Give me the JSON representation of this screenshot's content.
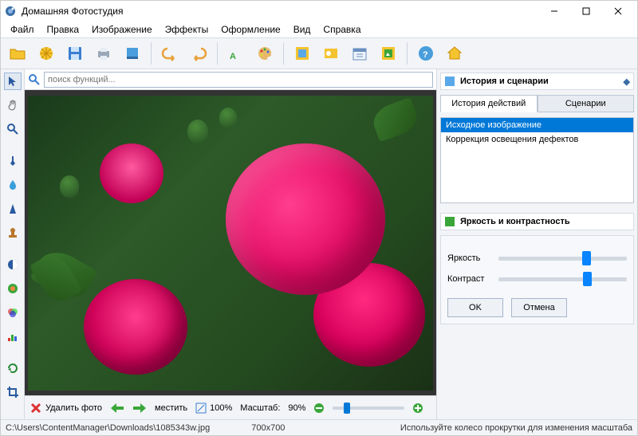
{
  "title": "Домашняя Фотостудия",
  "menu": [
    "Файл",
    "Правка",
    "Изображение",
    "Эффекты",
    "Оформление",
    "Вид",
    "Справка"
  ],
  "search": {
    "placeholder": "поиск функций..."
  },
  "right": {
    "history_title": "История и сценарии",
    "tabs": [
      "История действий",
      "Сценарии"
    ],
    "items": [
      "Исходное изображение",
      "Коррекция освещения дефектов"
    ],
    "bc_title": "Яркость и контрастность",
    "brightness_label": "Яркость",
    "contrast_label": "Контраст",
    "ok": "OK",
    "cancel": "Отмена"
  },
  "bottom": {
    "delete": "Удалить фото",
    "move": "местить",
    "fit": "100%",
    "scale_label": "Масштаб:",
    "scale_value": "90%"
  },
  "status": {
    "path": "C:\\Users\\ContentManager\\Downloads\\1085343w.jpg",
    "dim": "700x700",
    "hint": "Используйте колесо прокрутки для изменения масштаба"
  }
}
